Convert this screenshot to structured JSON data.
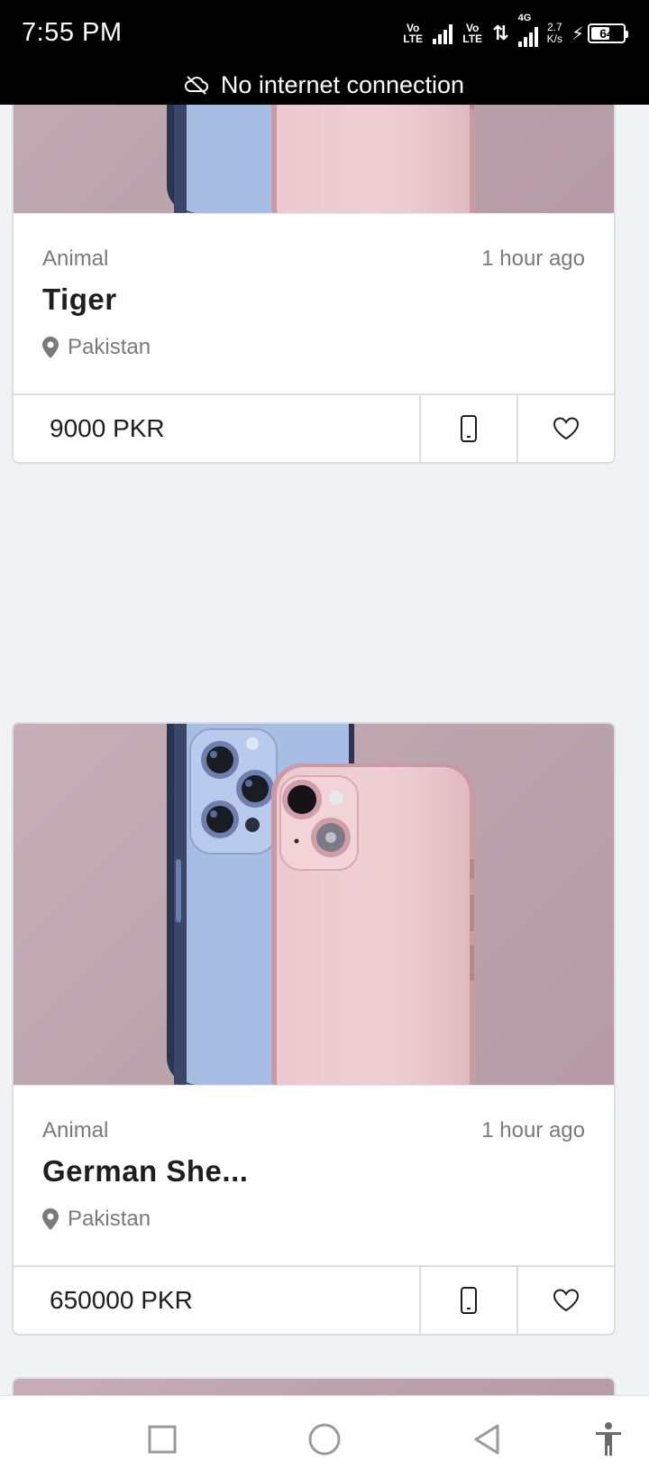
{
  "status_bar": {
    "time": "7:55 PM",
    "sim1_label": "Vo LTE",
    "sim2_label": "Vo LTE",
    "network_type": "4G",
    "net_speed_value": "2.7",
    "net_speed_unit": "K/s",
    "battery_percent": "64",
    "battery_level": 0.64,
    "offline_message": "No internet connection",
    "offline_icon": "cloud-off-icon"
  },
  "listings": [
    {
      "category": "Animal",
      "time_ago": "1 hour ago",
      "title": "Tiger",
      "location": "Pakistan",
      "price": "9000 PKR",
      "image": "two-iphones-photo",
      "call_icon": "phone-icon",
      "favorite_icon": "heart-icon"
    },
    {
      "category": "Animal",
      "time_ago": "1 hour ago",
      "title": "German She...",
      "location": "Pakistan",
      "price": "650000 PKR",
      "image": "two-iphones-photo",
      "call_icon": "phone-icon",
      "favorite_icon": "heart-icon"
    }
  ],
  "nav_bar": {
    "recents_icon": "square-icon",
    "home_icon": "circle-icon",
    "back_icon": "triangle-back-icon",
    "accessibility_icon": "accessibility-icon"
  },
  "colors": {
    "page_background": "#f1f2f6",
    "text_primary": "#1e1e1e",
    "text_secondary": "#7a7a7a",
    "border": "#dcdde2"
  }
}
